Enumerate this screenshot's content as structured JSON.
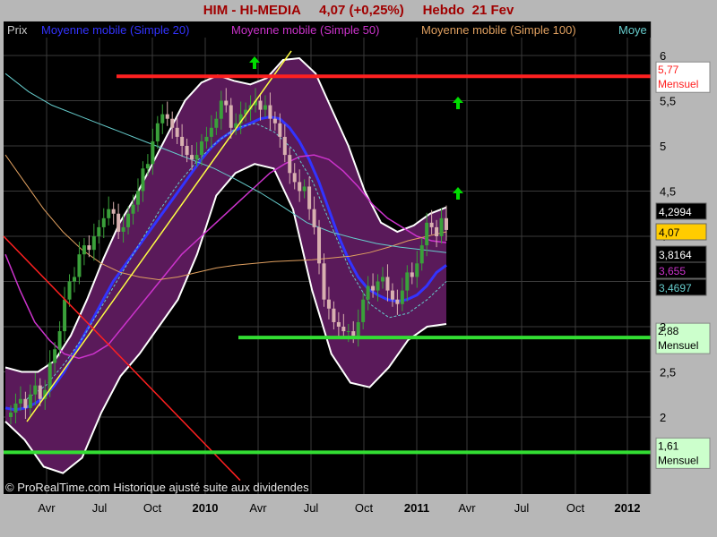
{
  "header": {
    "title": "HIM - HI-MEDIA     4,07 (+0,25%)     Hebdo  21 Fev"
  },
  "legend": [
    {
      "label": "Prix",
      "color": "#c8c8c8"
    },
    {
      "label": "Moyenne mobile (Simple 20)",
      "color": "#3333ff"
    },
    {
      "label": "Moyenne mobile (Simple 50)",
      "color": "#cc33cc"
    },
    {
      "label": "Moyenne mobile (Simple 100)",
      "color": "#e0a060"
    },
    {
      "label": "Moye",
      "color": "#66cccc"
    }
  ],
  "copyright": "© ProRealTime.com Historique ajusté suite aux dividendes",
  "colors": {
    "background": "#000000",
    "panel": "#b7b7b7",
    "band_fill": "#5a1a5a",
    "band_edge": "#ffffff",
    "candle_up": "#3aa03a",
    "candle_down": "#d8b0b0",
    "resistance": "#ff2020",
    "support": "#33dd33",
    "trendline_up": "#ffff44",
    "trendline_down": "#ff2020",
    "arrow": "#00dd00"
  },
  "chart_data": {
    "type": "candlestick",
    "title": "HIM - HI-MEDIA  4,07 (+0,25%)  Hebdo 21 Fev",
    "y_range": [
      1.3,
      6.05
    ],
    "y_ticks": [
      2,
      2.5,
      3,
      3.5,
      4,
      4.5,
      5,
      5.5,
      6
    ],
    "y_tick_labels": [
      "2",
      "2,5",
      "3",
      "3,5",
      "4",
      "4,5",
      "5",
      "5,5",
      "6"
    ],
    "x_ticks": [
      {
        "label": "Avr",
        "year": false
      },
      {
        "label": "Jul",
        "year": false
      },
      {
        "label": "Oct",
        "year": false
      },
      {
        "label": "2010",
        "year": true
      },
      {
        "label": "Avr",
        "year": false
      },
      {
        "label": "Jul",
        "year": false
      },
      {
        "label": "Oct",
        "year": false
      },
      {
        "label": "2011",
        "year": true
      },
      {
        "label": "Avr",
        "year": false
      },
      {
        "label": "Jul",
        "year": false
      },
      {
        "label": "Oct",
        "year": false
      },
      {
        "label": "2012",
        "year": true
      }
    ],
    "series": [
      {
        "name": "Prix",
        "type": "candle",
        "close": [
          2.05,
          2.15,
          2.2,
          2.1,
          2.25,
          2.35,
          2.2,
          2.3,
          2.6,
          2.75,
          2.95,
          3.3,
          3.5,
          3.55,
          3.8,
          3.9,
          3.85,
          4.0,
          4.1,
          4.2,
          4.3,
          4.25,
          4.05,
          4.1,
          4.25,
          4.35,
          4.5,
          4.75,
          4.8,
          5.05,
          5.25,
          5.35,
          5.3,
          5.2,
          5.1,
          5.0,
          4.9,
          4.85,
          4.9,
          5.05,
          5.1,
          5.2,
          5.3,
          5.5,
          5.45,
          5.2,
          5.25,
          5.35,
          5.4,
          5.45,
          5.5,
          5.4,
          5.45,
          5.3,
          5.25,
          5.1,
          4.9,
          4.7,
          4.6,
          4.5,
          4.55,
          4.3,
          4.1,
          3.7,
          3.3,
          3.2,
          3.05,
          3.0,
          2.95,
          2.95,
          2.9,
          3.05,
          3.3,
          3.45,
          3.4,
          3.5,
          3.55,
          3.4,
          3.3,
          3.25,
          3.4,
          3.6,
          3.55,
          3.7,
          3.9,
          4.15,
          4.1,
          4.0,
          4.2,
          4.07
        ]
      },
      {
        "name": "Moyenne mobile (Simple 20)",
        "values": [
          2.1,
          2.08,
          2.1,
          2.15,
          2.22,
          2.35,
          2.5,
          2.7,
          2.9,
          3.1,
          3.3,
          3.5,
          3.65,
          3.8,
          3.95,
          4.1,
          4.25,
          4.4,
          4.55,
          4.7,
          4.85,
          4.98,
          5.08,
          5.15,
          5.2,
          5.25,
          5.3,
          5.32,
          5.3,
          5.2,
          5.05,
          4.85,
          4.6,
          4.3,
          4.0,
          3.75,
          3.55,
          3.42,
          3.35,
          3.3,
          3.28,
          3.3,
          3.35,
          3.45,
          3.6,
          3.68
        ]
      },
      {
        "name": "Moyenne mobile (Simple 50)",
        "values": [
          3.8,
          3.4,
          3.05,
          2.85,
          2.7,
          2.65,
          2.7,
          2.8,
          3.0,
          3.2,
          3.4,
          3.6,
          3.8,
          3.95,
          4.1,
          4.25,
          4.4,
          4.55,
          4.7,
          4.8,
          4.88,
          4.9,
          4.85,
          4.72,
          4.55,
          4.35,
          4.2,
          4.1,
          4.0,
          3.95,
          3.93
        ]
      },
      {
        "name": "Moyenne mobile (Simple 100)",
        "values": [
          4.9,
          4.6,
          4.3,
          4.05,
          3.85,
          3.7,
          3.6,
          3.55,
          3.52,
          3.55,
          3.6,
          3.65,
          3.68,
          3.7,
          3.72,
          3.73,
          3.74,
          3.76,
          3.78,
          3.82,
          3.88,
          3.95,
          4.0,
          4.05
        ]
      },
      {
        "name": "Moye",
        "values": [
          5.8,
          5.6,
          5.45,
          5.35,
          5.25,
          5.15,
          5.05,
          4.95,
          4.85,
          4.75,
          4.62,
          4.48,
          4.32,
          4.15,
          4.05,
          3.98,
          3.92,
          3.88,
          3.85,
          3.82
        ]
      }
    ],
    "bollinger": {
      "upper": [
        2.55,
        2.5,
        2.5,
        2.62,
        2.9,
        3.3,
        3.75,
        4.15,
        4.45,
        4.8,
        5.15,
        5.5,
        5.7,
        5.78,
        5.72,
        5.68,
        5.75,
        5.95,
        5.97,
        5.8,
        5.4,
        5.0,
        4.5,
        4.15,
        4.05,
        4.12,
        4.25,
        4.32
      ],
      "lower": [
        1.95,
        1.75,
        1.45,
        1.38,
        1.55,
        2.05,
        2.45,
        2.7,
        3.0,
        3.3,
        3.8,
        4.45,
        4.7,
        4.8,
        4.75,
        4.3,
        3.4,
        2.7,
        2.38,
        2.33,
        2.55,
        2.85,
        3.0,
        3.03
      ]
    },
    "horizontal_levels": [
      {
        "value": 5.77,
        "label": "5,77",
        "sublabel": "Mensuel",
        "color": "#ff2020"
      },
      {
        "value": 2.88,
        "label": "2,88",
        "sublabel": "Mensuel",
        "color": "#33dd33"
      },
      {
        "value": 1.61,
        "label": "1,61",
        "sublabel": "Mensuel",
        "color": "#33dd33"
      }
    ],
    "price_labels": [
      {
        "value": 4.2994,
        "label": "4,2994",
        "bg": "#000000",
        "fg": "#ffffff"
      },
      {
        "value": 4.07,
        "label": "4,07",
        "bg": "#ffcc00",
        "fg": "#000000"
      },
      {
        "value": 3.8164,
        "label": "3,8164",
        "bg": "#000000",
        "fg": "#ffffff"
      },
      {
        "value": 3.655,
        "label": "3,655",
        "bg": "#000000",
        "fg": "#cc33cc"
      },
      {
        "value": 3.4697,
        "label": "3,4697",
        "bg": "#000000",
        "fg": "#66cccc"
      }
    ]
  }
}
